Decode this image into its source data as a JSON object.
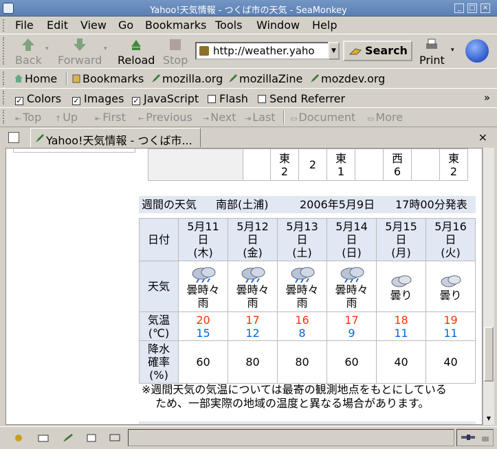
{
  "window": {
    "title": "Yahoo!天気情報 - つくば市の天気 - SeaMonkey"
  },
  "menu": [
    "File",
    "Edit",
    "View",
    "Go",
    "Bookmarks",
    "Tools",
    "Window",
    "Help"
  ],
  "nav": {
    "back": "Back",
    "forward": "Forward",
    "reload": "Reload",
    "stop": "Stop",
    "url": "http://weather.yaho",
    "search": "Search",
    "print": "Print"
  },
  "bookmarks": {
    "home": "Home",
    "bookmarks": "Bookmarks",
    "mozilla": "mozilla.org",
    "mozillazine": "mozillaZine",
    "mozdev": "mozdev.org"
  },
  "prefs": {
    "colors": "Colors",
    "images": "Images",
    "javascript": "JavaScript",
    "flash": "Flash",
    "referrer": "Send Referrer",
    "more": "»"
  },
  "sitenav": {
    "top": "Top",
    "up": "Up",
    "first": "First",
    "previous": "Previous",
    "next": "Next",
    "last": "Last",
    "document": "Document",
    "more": "More"
  },
  "tab": {
    "label": "Yahoo!天気情報 - つくば市...",
    "close": "×"
  },
  "wind_row": [
    [
      "東",
      "2"
    ],
    [
      "2",
      ""
    ],
    [
      "東",
      "1"
    ],
    [
      "",
      ""
    ],
    [
      "西",
      "6"
    ],
    [
      "",
      ""
    ],
    [
      "東",
      "2"
    ]
  ],
  "weekly": {
    "header": "週間の天気",
    "region": "南部(土浦)",
    "date": "2006年5月9日",
    "issued": "17時00分発表",
    "labels": {
      "date": "日付",
      "weather": "天気",
      "temp1": "気温",
      "temp2": "(℃)",
      "pop1": "降水",
      "pop2": "確率",
      "pop3": "(%)"
    },
    "days": [
      {
        "d1": "5月11",
        "d2": "日",
        "dow": "(木)",
        "w1": "曇時々",
        "w2": "雨",
        "icon": "cloud-rain-icon",
        "hi": "20",
        "lo": "15",
        "pop": "60"
      },
      {
        "d1": "5月12",
        "d2": "日",
        "dow": "(金)",
        "w1": "曇時々",
        "w2": "雨",
        "icon": "cloud-rain-icon",
        "hi": "17",
        "lo": "12",
        "pop": "80"
      },
      {
        "d1": "5月13",
        "d2": "日",
        "dow": "(土)",
        "w1": "曇時々",
        "w2": "雨",
        "icon": "cloud-rain-icon",
        "hi": "16",
        "lo": "8",
        "pop": "80"
      },
      {
        "d1": "5月14",
        "d2": "日",
        "dow": "(日)",
        "w1": "曇時々",
        "w2": "雨",
        "icon": "cloud-rain-icon",
        "hi": "17",
        "lo": "9",
        "pop": "60"
      },
      {
        "d1": "5月15",
        "d2": "日",
        "dow": "(月)",
        "w1": "曇り",
        "w2": "",
        "icon": "cloud-icon",
        "hi": "18",
        "lo": "11",
        "pop": "40"
      },
      {
        "d1": "5月16",
        "d2": "日",
        "dow": "(火)",
        "w1": "曇り",
        "w2": "",
        "icon": "cloud-icon",
        "hi": "19",
        "lo": "11",
        "pop": "40"
      }
    ],
    "note1": "※週間天気の気温については最寄の観測地点をもとにしている",
    "note2": "ため、一部実際の地域の温度と異なる場合があります。"
  },
  "colors": {
    "high": "#ff3300",
    "low": "#0066dd",
    "header_bg": "#e1e7f3"
  }
}
